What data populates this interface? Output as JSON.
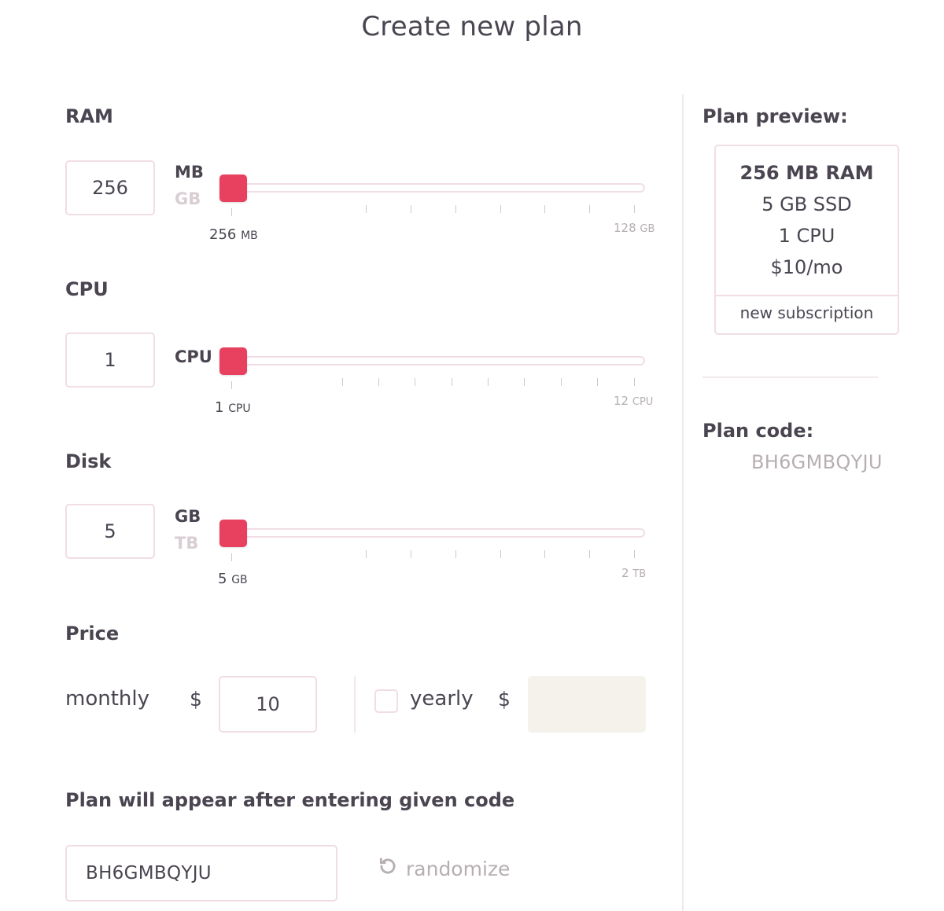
{
  "title": "Create new plan",
  "ram": {
    "label": "RAM",
    "value": "256",
    "unit_active": "MB",
    "unit_inactive": "GB",
    "slider_level": 0,
    "min_value": "256",
    "min_unit": "MB",
    "max_value": "128",
    "max_unit": "GB"
  },
  "cpu": {
    "label": "CPU",
    "value": "1",
    "unit_active": "CPU",
    "slider_level": 0,
    "min_value": "1",
    "min_unit": "CPU",
    "max_value": "12",
    "max_unit": "CPU"
  },
  "disk": {
    "label": "Disk",
    "value": "5",
    "unit_active": "GB",
    "unit_inactive": "TB",
    "slider_level": 0,
    "min_value": "5",
    "min_unit": "GB",
    "max_value": "2",
    "max_unit": "TB"
  },
  "price": {
    "label": "Price",
    "monthly_label": "monthly",
    "currency": "$",
    "monthly_value": "10",
    "yearly_label": "yearly",
    "yearly_checked": false,
    "yearly_value": ""
  },
  "code_section": {
    "heading": "Plan will appear after entering given code",
    "code_value": "BH6GMBQYJU",
    "randomize_label": "randomize",
    "randomize_icon": "refresh-icon"
  },
  "sidebar": {
    "preview_label": "Plan preview:",
    "preview": {
      "ram": "256 MB RAM",
      "disk": "5 GB SSD",
      "cpu": "1 CPU",
      "price": "$10/mo",
      "footer": "new subscription"
    },
    "code_label": "Plan code:",
    "code_value": "BH6GMBQYJU"
  },
  "colors": {
    "accent": "#e8405f",
    "border": "#f1dde5",
    "text": "#4a4550",
    "muted": "#b6aeb3",
    "disabled_fill": "#f5f2ec"
  }
}
